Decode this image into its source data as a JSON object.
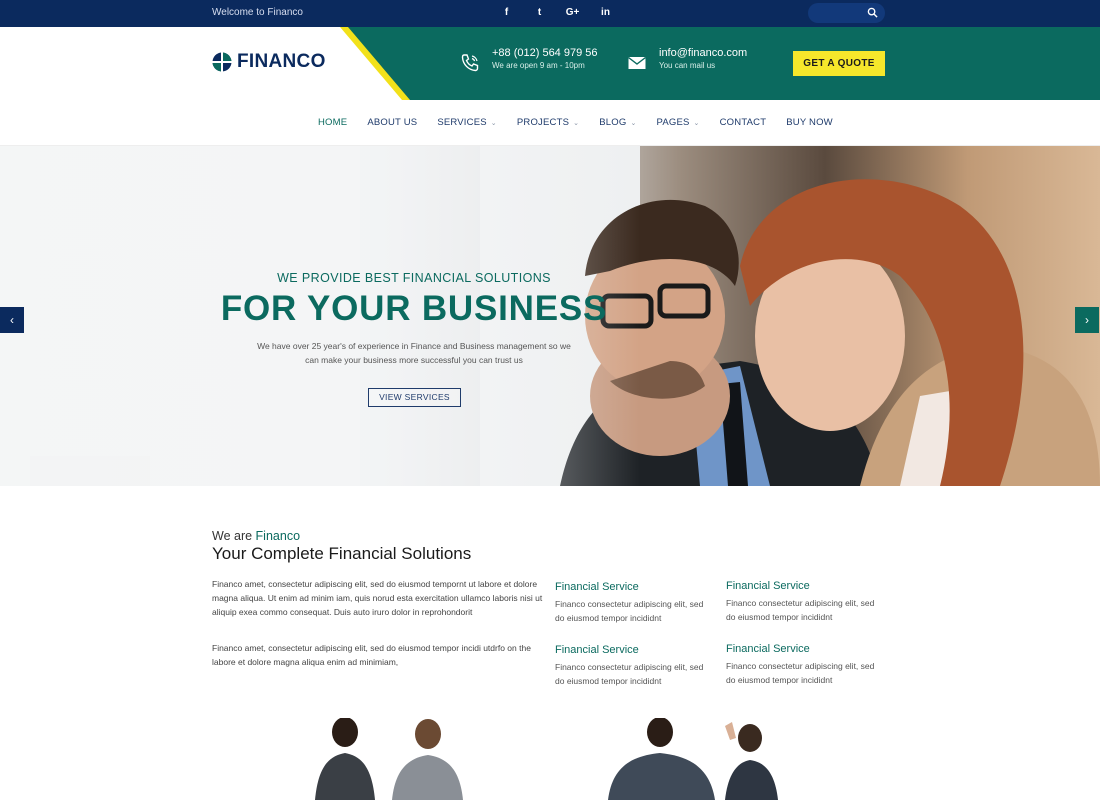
{
  "topbar": {
    "welcome": "Welcome to Financo",
    "socials": [
      {
        "icon": "facebook-icon",
        "glyph": "f"
      },
      {
        "icon": "twitter-icon",
        "glyph": "t"
      },
      {
        "icon": "google-plus-icon",
        "glyph": "G+"
      },
      {
        "icon": "linkedin-icon",
        "glyph": "in"
      }
    ]
  },
  "header": {
    "logo_text": "FINANCO",
    "phone": {
      "main": "+88 (012) 564 979 56",
      "sub": "We are open 9 am - 10pm"
    },
    "mail": {
      "main": "info@financo.com",
      "sub": "You can mail us"
    },
    "quote_label": "GET A QUOTE"
  },
  "nav": {
    "items": [
      {
        "label": "HOME",
        "dropdown": false,
        "active": true
      },
      {
        "label": "ABOUT US",
        "dropdown": false
      },
      {
        "label": "SERVICES",
        "dropdown": true
      },
      {
        "label": "PROJECTS",
        "dropdown": true
      },
      {
        "label": "BLOG",
        "dropdown": true
      },
      {
        "label": "PAGES",
        "dropdown": true
      },
      {
        "label": "CONTACT",
        "dropdown": false
      },
      {
        "label": "BUY NOW",
        "dropdown": false
      }
    ],
    "caret": "⌄"
  },
  "hero": {
    "tagline": "WE PROVIDE BEST FINANCIAL SOLUTIONS",
    "headline": "FOR YOUR BUSINESS",
    "description": "We have over 25  year's of experience in Finance and Business management so we can make your business more successful you can trust us",
    "button_label": "VIEW SERVICES",
    "prev_glyph": "‹",
    "next_glyph": "›"
  },
  "about": {
    "kicker_prefix": "We are ",
    "kicker_brand": "Financo",
    "heading": "Your Complete Financial Solutions",
    "paragraph1": "Financo amet, consectetur adipiscing elit, sed do eiusmod tempornt ut labore et dolore magna aliqua. Ut enim ad minim iam, quis norud esta exercitation ullamco laboris nisi ut aliquip exea commo consequat. Duis auto iruro dolor in reprohondorit",
    "paragraph2": "Financo amet, consectetur adipiscing elit, sed do eiusmod tempor incidi utdrfo on the labore et dolore magna aliqua enim ad minimiam,",
    "services": [
      {
        "title": "Financial Service",
        "text": "Financo consectetur adipiscing elit, sed do eiusmod tempor incididnt"
      },
      {
        "title": "Financial Service",
        "text": "Financo consectetur adipiscing elit, sed do eiusmod tempor incididnt"
      },
      {
        "title": "Financial Service",
        "text": "Financo consectetur adipiscing elit, sed do eiusmod tempor incididnt"
      },
      {
        "title": "Financial Service",
        "text": "Financo consectetur adipiscing elit, sed do eiusmod tempor incididnt"
      }
    ]
  },
  "colors": {
    "navy": "#0b2a5e",
    "teal": "#0b6a5f",
    "yellow": "#f6e72b"
  }
}
